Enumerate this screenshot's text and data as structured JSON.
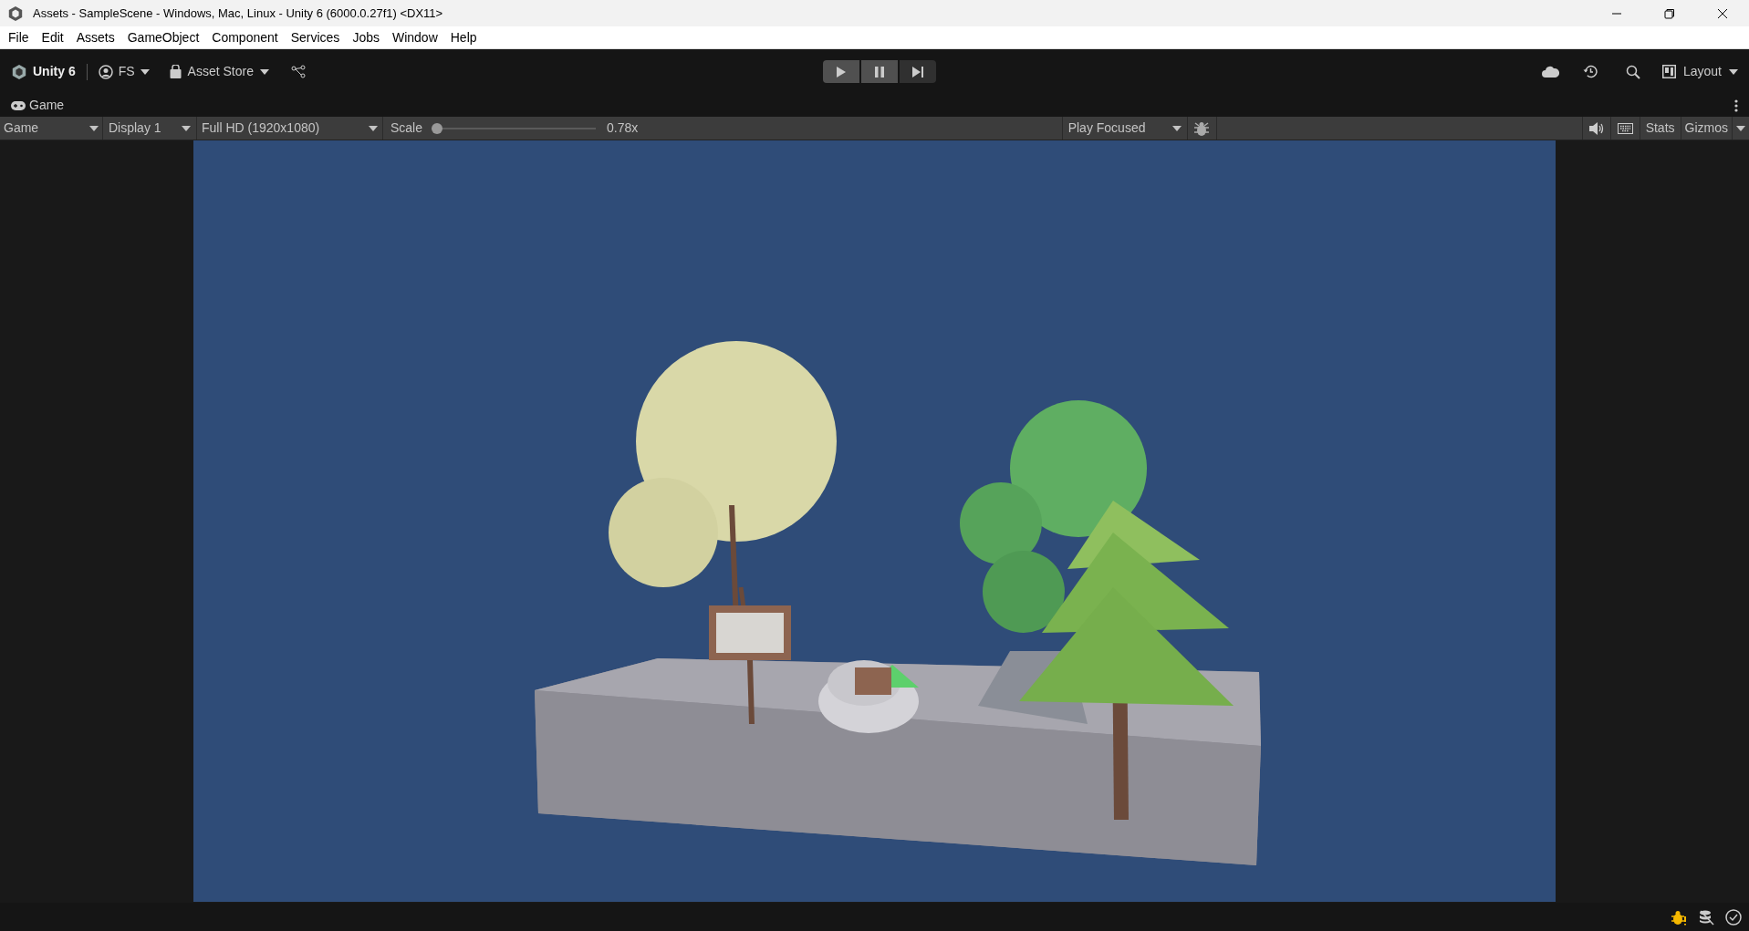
{
  "window": {
    "title": "Assets - SampleScene - Windows, Mac, Linux - Unity 6 (6000.0.27f1) <DX11>"
  },
  "menu": [
    "File",
    "Edit",
    "Assets",
    "GameObject",
    "Component",
    "Services",
    "Jobs",
    "Window",
    "Help"
  ],
  "toolbar": {
    "brand": "Unity 6",
    "account": "FS",
    "store": "Asset Store",
    "layout": "Layout"
  },
  "tab": {
    "label": "Game"
  },
  "game_bar": {
    "view": "Game",
    "display": "Display 1",
    "resolution": "Full HD (1920x1080)",
    "scale_label": "Scale",
    "scale": {
      "level": 0.0
    },
    "scale_reading": "0.78x",
    "play_mode": "Play Focused",
    "stats": "Stats",
    "gizmos": "Gizmos"
  }
}
